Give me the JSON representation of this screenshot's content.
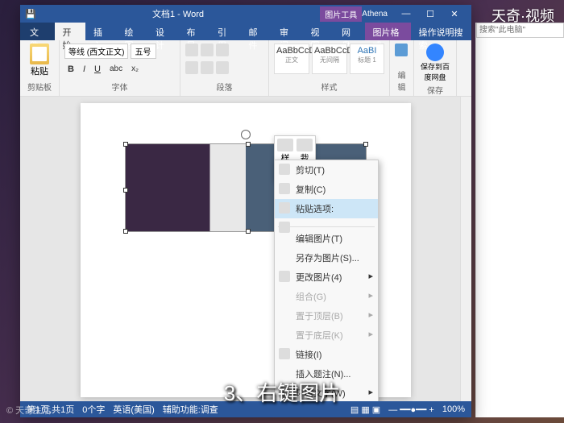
{
  "brand": "天奇·视频",
  "watermark": "© 天奇生活",
  "caption": "3、右键图片",
  "titlebar": {
    "title": "文档1 - Word",
    "user": "Athena",
    "contextTab": "图片工具",
    "contextSub": "图片格式",
    "help": "操作说明搜索"
  },
  "winbtns": {
    "min": "—",
    "max": "☐",
    "close": "✕"
  },
  "menu": {
    "file": "文件",
    "tabs": [
      "开始",
      "插入",
      "绘图",
      "设计",
      "布局",
      "引用",
      "邮件",
      "审阅",
      "视图",
      "网盘"
    ]
  },
  "ribbon": {
    "clipboard": {
      "label": "剪贴板",
      "paste": "粘贴"
    },
    "font": {
      "label": "字体",
      "family": "等线 (西文正文)",
      "size": "五号"
    },
    "para": {
      "label": "段落"
    },
    "styles": {
      "label": "样式",
      "items": [
        {
          "preview": "AaBbCcD",
          "name": "正文"
        },
        {
          "preview": "AaBbCcD",
          "name": "无间隔"
        },
        {
          "preview": "AaBI",
          "name": "标题 1"
        }
      ]
    },
    "edit": {
      "label": "编辑"
    },
    "baidu": {
      "label": "保存",
      "btn": "保存到百度网盘"
    }
  },
  "minitoolbar": {
    "style": "样式",
    "crop": "裁剪"
  },
  "context": {
    "cut": "剪切(T)",
    "copy": "复制(C)",
    "pasteOptions": "粘贴选项:",
    "editPic": "编辑图片(T)",
    "saveAs": "另存为图片(S)...",
    "change": "更改图片(4)",
    "group": "组合(G)",
    "bringFront": "置于顶层(B)",
    "sendBack": "置于底层(K)",
    "link": "链接(I)",
    "insertCaption": "插入题注(N)...",
    "wrap": "环绕文字(W)"
  },
  "status": {
    "page": "第1页,共1页",
    "words": "0个字",
    "lang": "英语(美国)",
    "access": "辅助功能:调查",
    "zoom": "100%"
  },
  "side": {
    "search": "搜索\"此电脑\""
  }
}
